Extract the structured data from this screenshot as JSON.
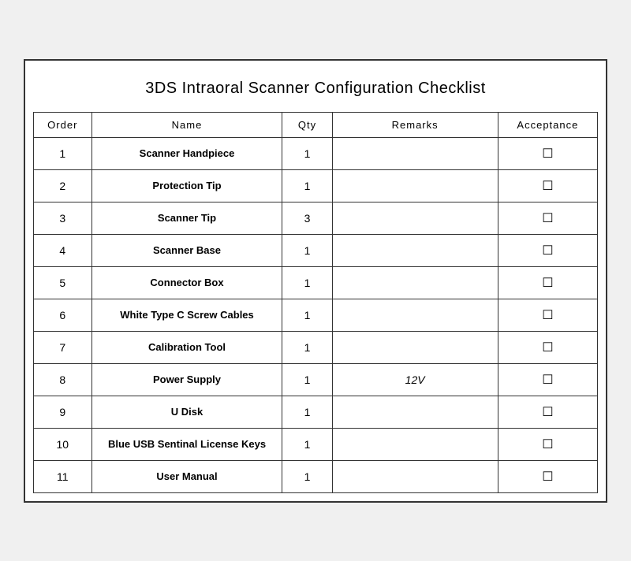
{
  "title": "3DS Intraoral Scanner Configuration Checklist",
  "columns": {
    "order": "Order",
    "name": "Name",
    "qty": "Qty",
    "remarks": "Remarks",
    "acceptance": "Acceptance"
  },
  "rows": [
    {
      "order": "1",
      "name": "Scanner Handpiece",
      "qty": "1",
      "remarks": "",
      "acceptance": "☐"
    },
    {
      "order": "2",
      "name": "Protection Tip",
      "qty": "1",
      "remarks": "",
      "acceptance": "☐"
    },
    {
      "order": "3",
      "name": "Scanner Tip",
      "qty": "3",
      "remarks": "",
      "acceptance": "☐"
    },
    {
      "order": "4",
      "name": "Scanner Base",
      "qty": "1",
      "remarks": "",
      "acceptance": "☐"
    },
    {
      "order": "5",
      "name": "Connector Box",
      "qty": "1",
      "remarks": "",
      "acceptance": "☐"
    },
    {
      "order": "6",
      "name": "White Type C Screw Cables",
      "qty": "1",
      "remarks": "",
      "acceptance": "☐"
    },
    {
      "order": "7",
      "name": "Calibration Tool",
      "qty": "1",
      "remarks": "",
      "acceptance": "☐"
    },
    {
      "order": "8",
      "name": "Power Supply",
      "qty": "1",
      "remarks": "12V",
      "acceptance": "☐"
    },
    {
      "order": "9",
      "name": "U Disk",
      "qty": "1",
      "remarks": "",
      "acceptance": "☐"
    },
    {
      "order": "10",
      "name": "Blue USB Sentinal License Keys",
      "qty": "1",
      "remarks": "",
      "acceptance": "☐"
    },
    {
      "order": "11",
      "name": "User Manual",
      "qty": "1",
      "remarks": "",
      "acceptance": "☐"
    }
  ]
}
